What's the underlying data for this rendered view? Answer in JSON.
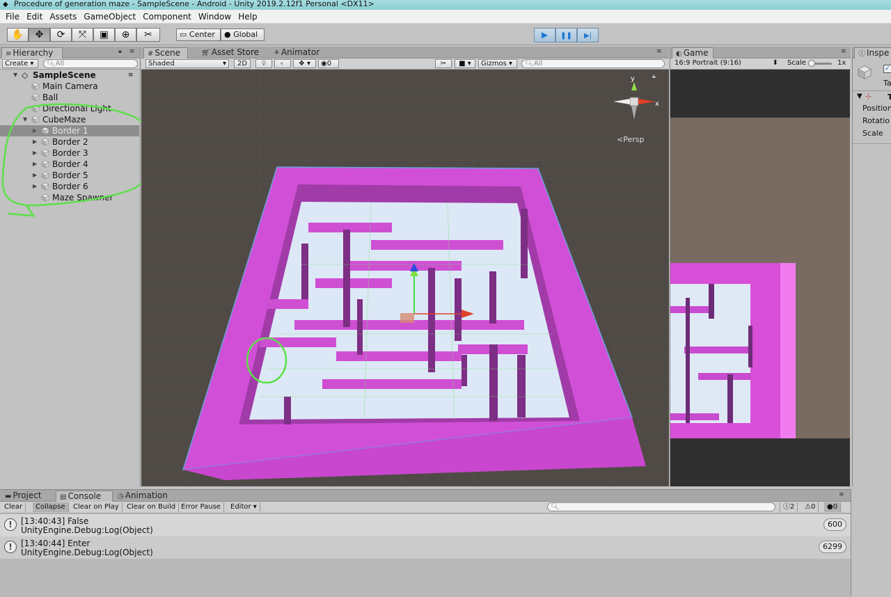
{
  "window": {
    "title": "Procedure of generation maze - SampleScene - Android - Unity 2019.2.12f1 Personal <DX11>"
  },
  "menu": [
    "File",
    "Edit",
    "Assets",
    "GameObject",
    "Component",
    "Window",
    "Help"
  ],
  "toolbar": {
    "tools": [
      "hand-tool",
      "move-tool",
      "rotate-tool",
      "scale-tool",
      "rect-tool",
      "transform-tool",
      "custom-tool"
    ],
    "pivot_mode": "Center",
    "pivot_rotation": "Global",
    "play_glyph": "▶",
    "pause_glyph": "❚❚",
    "step_glyph": "▶|"
  },
  "hierarchy": {
    "tab": "Hierarchy",
    "create": "Create",
    "search_placeholder": "All",
    "scene": "SampleScene",
    "items": [
      "Main Camera",
      "Ball",
      "Directional Light",
      "CubeMaze",
      "Border 1",
      "Border 2",
      "Border 3",
      "Border 4",
      "Border 5",
      "Border 6",
      "Maze Spawner"
    ]
  },
  "scene_view": {
    "tabs": [
      "Scene",
      "Asset Store",
      "Animator"
    ],
    "shading": "Shaded",
    "mode_2d": "2D",
    "audio_count": "0",
    "gizmos": "Gizmos",
    "search_placeholder": "All",
    "persp": "Persp",
    "gizmo_y": "y",
    "gizmo_x": "x"
  },
  "game_view": {
    "tab": "Game",
    "aspect": "16:9 Portrait (9:16)",
    "scale_label": "Scale",
    "scale_value": "1x"
  },
  "inspector": {
    "tab": "Inspe",
    "tag": "Tag",
    "component_initial": "T",
    "fields": [
      "Position",
      "Rotatio",
      "Scale"
    ]
  },
  "bottom": {
    "tabs": [
      "Project",
      "Console",
      "Animation"
    ],
    "buttons": [
      "Clear",
      "Collapse",
      "Clear on Play",
      "Clear on Build",
      "Error Pause",
      "Editor"
    ],
    "counts": {
      "warnings": "2",
      "messages": "0",
      "errors": "0"
    },
    "logs": [
      {
        "line1": "[13:40:43] False",
        "line2": "UnityEngine.Debug:Log(Object)",
        "count": "600"
      },
      {
        "line1": "[13:40:44] Enter",
        "line2": "UnityEngine.Debug:Log(Object)",
        "count": "6299"
      }
    ]
  },
  "colors": {
    "maze_wall": "#d84fd8",
    "maze_floor": "#dce8f6",
    "scene_bg": "#4f4a45",
    "annotation": "#5de04a"
  }
}
